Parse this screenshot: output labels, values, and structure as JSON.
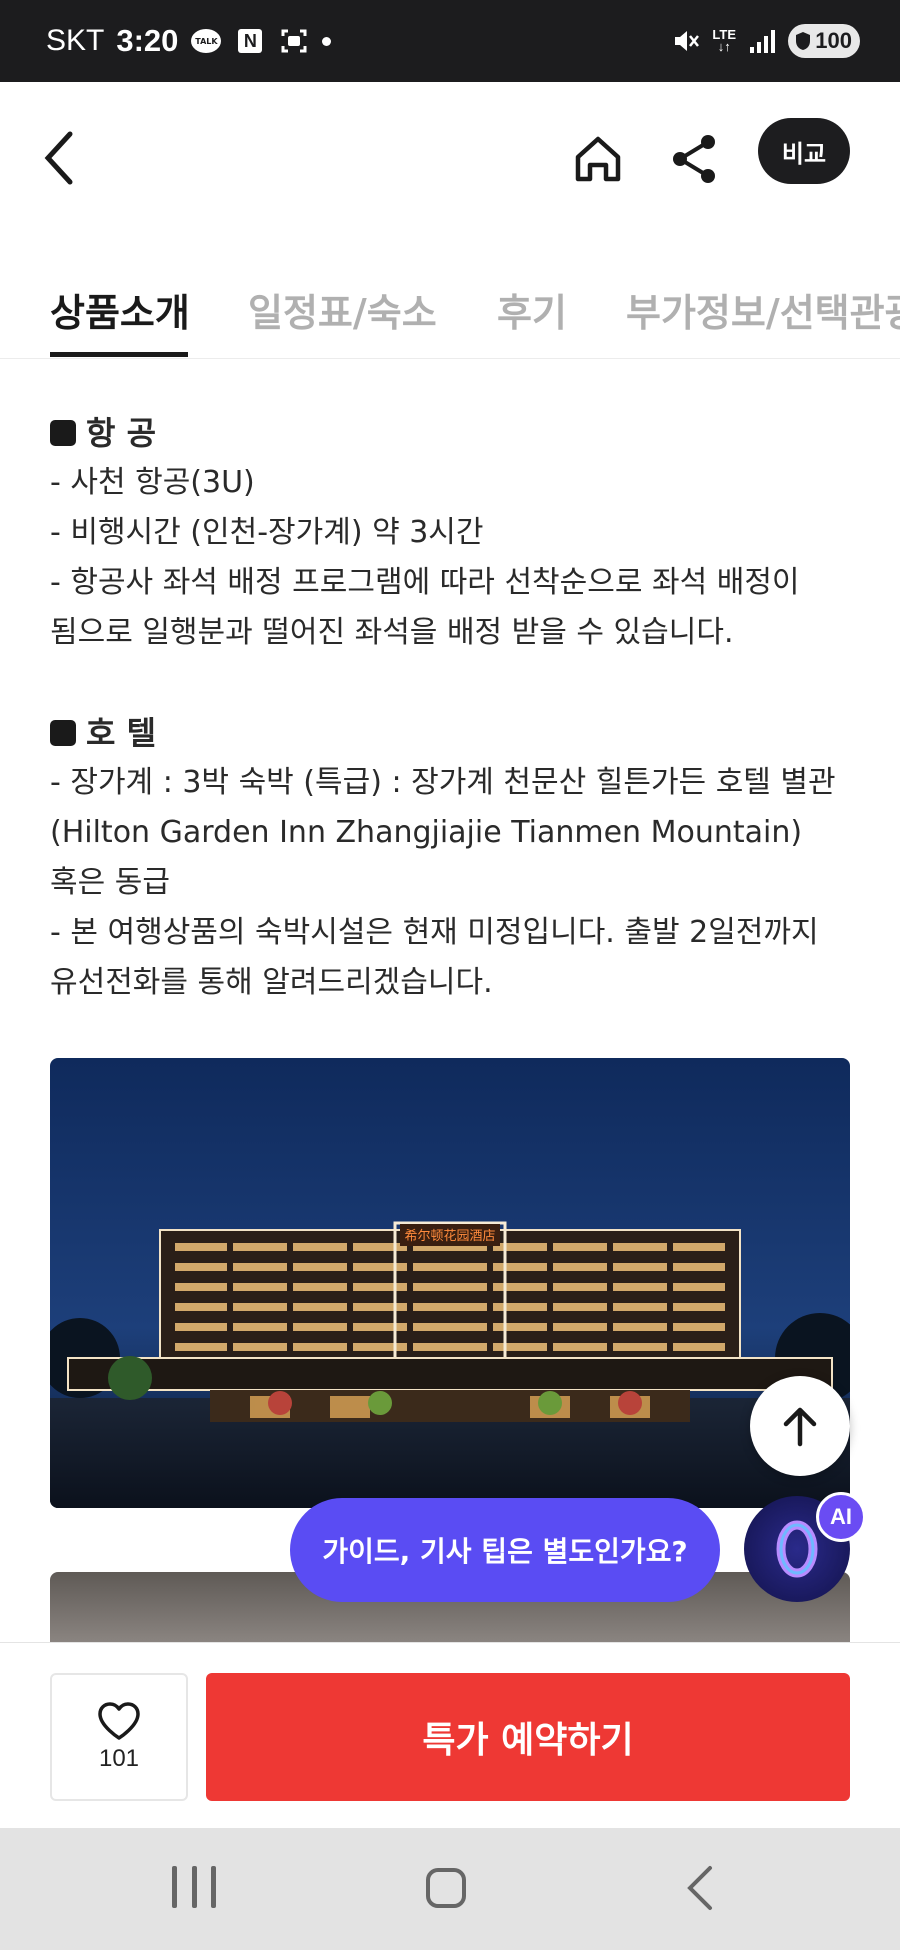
{
  "status_bar": {
    "carrier": "SKT",
    "time": "3:20",
    "talk_icon_text": "TALK",
    "n_icon_text": "N",
    "lte_text": "LTE",
    "battery": "100"
  },
  "header": {
    "compare_label": "비교"
  },
  "tabs": [
    {
      "label": "상품소개",
      "active": true
    },
    {
      "label": "일정표/숙소",
      "active": false
    },
    {
      "label": "후기",
      "active": false
    },
    {
      "label": "부가정보/선택관광",
      "active": false
    }
  ],
  "content": {
    "flight": {
      "title": "항 공",
      "lines": [
        "- 사천 항공(3U)",
        "- 비행시간 (인천-장가계) 약 3시간",
        "- 항공사 좌석 배정 프로그램에 따라 선착순으로 좌석 배정이 됨으로 일행분과 떨어진 좌석을 배정 받을 수 있습니다."
      ]
    },
    "hotel": {
      "title": "호 텔",
      "lines": [
        "- 장가계 : 3박 숙박 (특급) : 장가계 천문산 힐튼가든 호텔 별관(Hilton Garden Inn Zhangjiajie Tianmen Mountain) 혹은 동급",
        "- 본 여행상품의 숙박시설은 현재 미정입니다. 출발 2일전까지 유선전화를 통해 알려드리겠습니다."
      ]
    },
    "hotel_sign": "希尔顿花园酒店"
  },
  "ai_chip": {
    "question": "가이드, 기사 팁은 별도인가요?",
    "badge": "AI"
  },
  "bottom_bar": {
    "like_count": "101",
    "book_label": "특가 예약하기"
  },
  "colors": {
    "book_button": "#ee3834",
    "ai_chip": "#5a4cf3",
    "compare_button": "#1d1d1f"
  }
}
